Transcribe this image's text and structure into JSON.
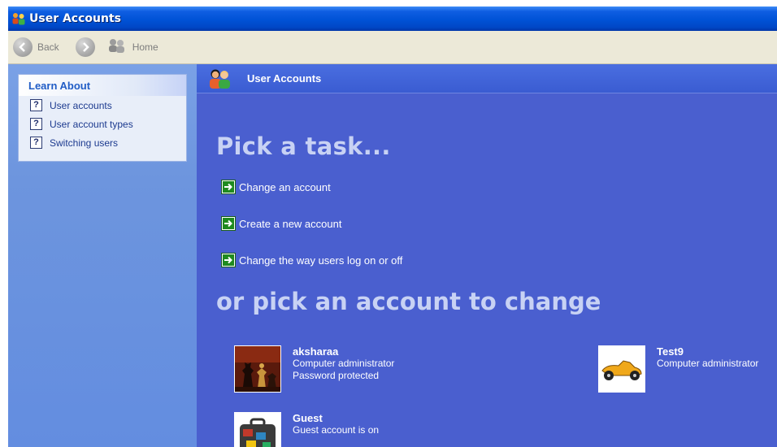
{
  "window": {
    "title": "User Accounts"
  },
  "toolbar": {
    "back_label": "Back",
    "home_label": "Home"
  },
  "sidebar": {
    "heading": "Learn About",
    "items": [
      {
        "label": "User accounts"
      },
      {
        "label": "User account types"
      },
      {
        "label": "Switching users"
      }
    ]
  },
  "main": {
    "header_title": "User Accounts",
    "task_heading": "Pick a task...",
    "tasks": [
      {
        "label": "Change an account"
      },
      {
        "label": "Create a new account"
      },
      {
        "label": "Change the way users log on or off"
      }
    ],
    "account_heading": "or pick an account to change",
    "accounts": [
      {
        "name": "aksharaa",
        "lines": [
          "Computer administrator",
          "Password protected"
        ],
        "picture": "chess-pieces"
      },
      {
        "name": "Test9",
        "lines": [
          "Computer administrator"
        ],
        "picture": "race-car"
      },
      {
        "name": "Guest",
        "lines": [
          "Guest account is on"
        ],
        "picture": "suitcase"
      }
    ]
  },
  "colors": {
    "main_bg": "#4a5fcf",
    "sidebar_bg": "#6d95de",
    "titlebar": "#0052d6",
    "link_text": "#1c3a8f"
  },
  "icons": [
    "users-icon",
    "back-arrow-icon",
    "forward-arrow-icon",
    "home-users-icon",
    "help-question-icon",
    "green-arrow-icon"
  ]
}
